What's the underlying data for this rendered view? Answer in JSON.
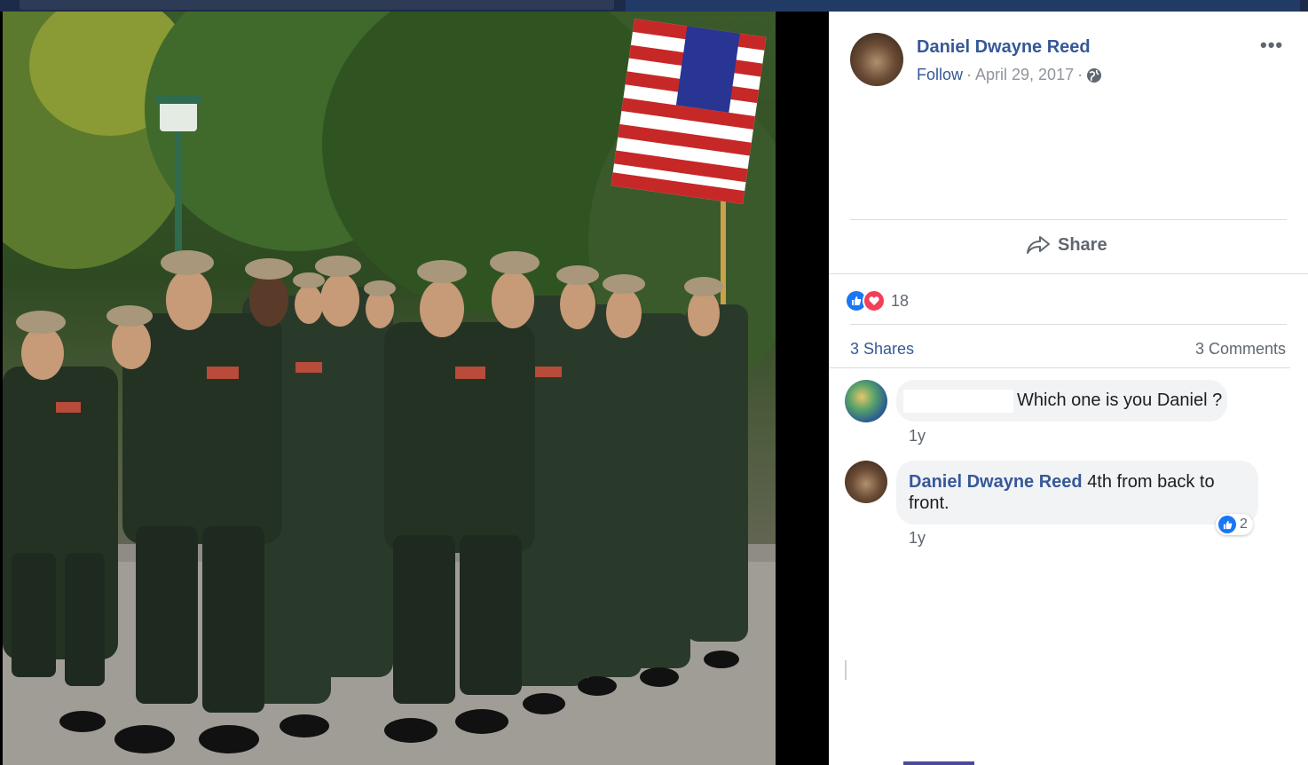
{
  "colors": {
    "link_blue": "#365899",
    "meta_gray": "#90949c",
    "text_gray": "#606770",
    "like_blue": "#1877f2",
    "love_red": "#f33e58",
    "bubble_bg": "#f2f3f5"
  },
  "post": {
    "author": "Daniel Dwayne Reed",
    "follow_label": "Follow",
    "separator": "·",
    "date": "April 29, 2017",
    "privacy_icon": "globe-icon",
    "more_label": "•••",
    "share_label": "Share",
    "reaction_count": "18",
    "shares_label": "3 Shares",
    "comments_label": "3 Comments"
  },
  "comments": [
    {
      "author": "",
      "text": "Which one is you Daniel ?",
      "time": "1y"
    },
    {
      "author": "Daniel Dwayne Reed",
      "text": "4th from back to front.",
      "time": "1y",
      "likes": "2"
    }
  ]
}
